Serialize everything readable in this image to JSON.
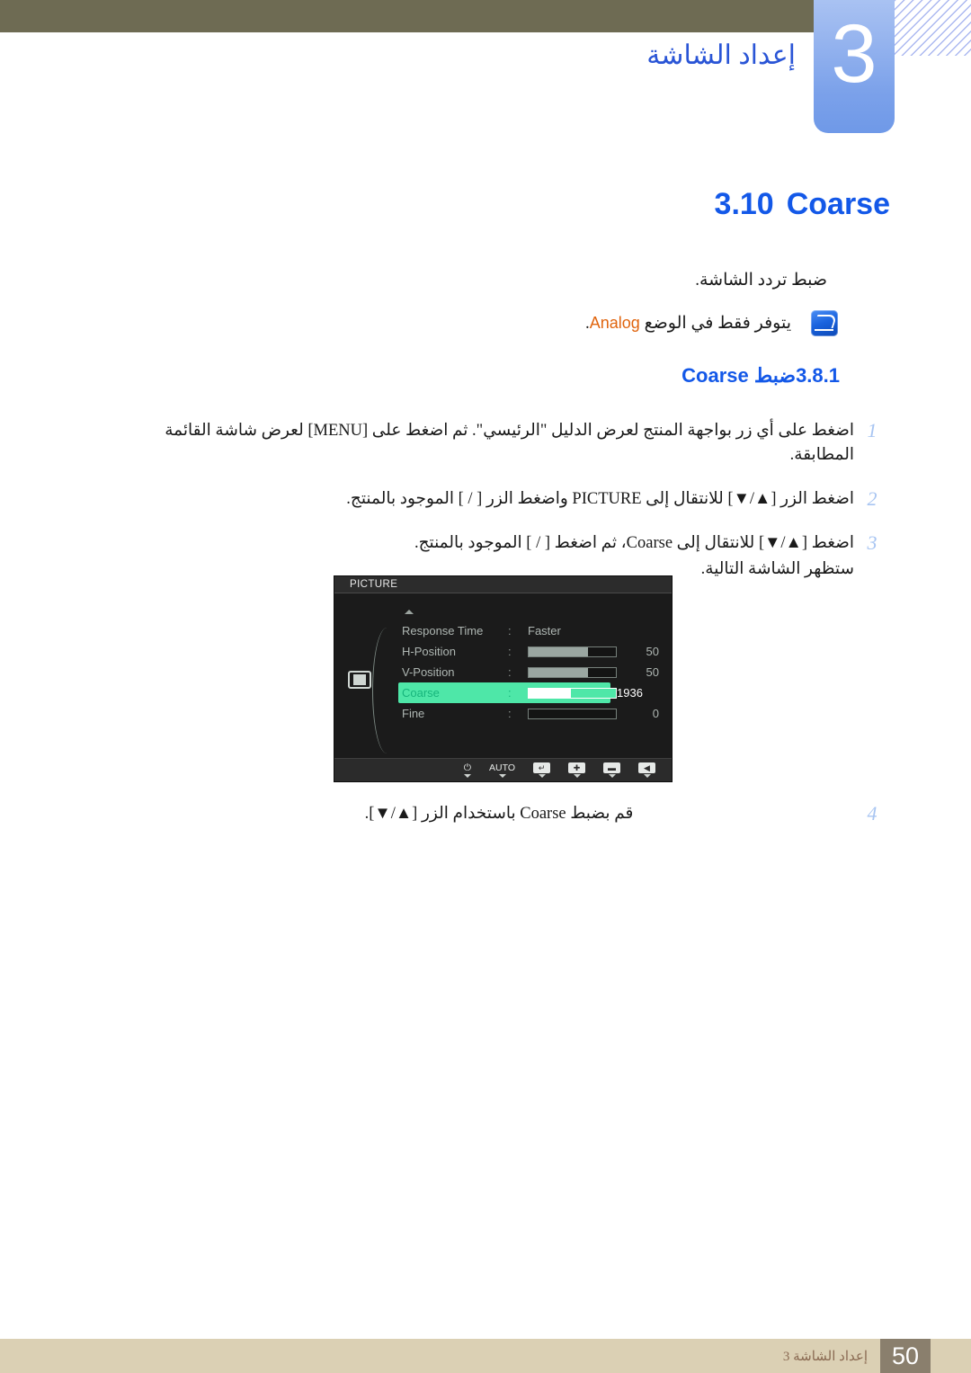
{
  "header": {
    "chapter_number": "3",
    "chapter_title": "إعداد الشاشة"
  },
  "section": {
    "number": "3.10",
    "title": "Coarse"
  },
  "intro": {
    "text": "ضبط تردد الشاشة."
  },
  "note": {
    "icon": "note-pencil-icon",
    "prefix": "يتوفر فقط في الوضع",
    "keyword": "Analog",
    "suffix": "."
  },
  "subsection": {
    "number": "3.8.1",
    "label_ar": "ضبط",
    "label_en": "Coarse"
  },
  "steps": [
    {
      "num": "1",
      "text": "اضغط على أي زر بواجهة المنتج لعرض الدليل \"الرئيسي\". ثم اضغط على [MENU] لعرض شاشة القائمة المطابقة."
    },
    {
      "num": "2",
      "text": "اضغط الزر [▲/▼] للانتقال إلى PICTURE واضغط الزر [ /  ] الموجود بالمنتج."
    },
    {
      "num": "3",
      "text": "اضغط [▲/▼] للانتقال إلى Coarse، ثم اضغط [ /  ] الموجود بالمنتج.",
      "sub": "ستظهر الشاشة التالية."
    },
    {
      "num": "4",
      "text": "قم بضبط Coarse باستخدام الزر [▲/▼]."
    }
  ],
  "osd": {
    "title": "PICTURE",
    "side_icon": "picture-bars-icon",
    "rows": [
      {
        "label": "Response Time",
        "colon": ":",
        "type": "value",
        "value": "Faster"
      },
      {
        "label": "H-Position",
        "colon": ":",
        "type": "bar",
        "fill": 68,
        "value": "50"
      },
      {
        "label": "V-Position",
        "colon": ":",
        "type": "bar",
        "fill": 68,
        "value": "50"
      },
      {
        "label": "Coarse",
        "colon": ":",
        "type": "bar",
        "fill": 48,
        "value": "1936",
        "selected": true
      },
      {
        "label": "Fine",
        "colon": ":",
        "type": "bar",
        "fill": 0,
        "value": "0"
      }
    ],
    "footer_buttons": [
      {
        "name": "left-arrow-button",
        "glyph": "◀"
      },
      {
        "name": "minus-button",
        "glyph": "▬"
      },
      {
        "name": "plus-button",
        "glyph": "✚"
      },
      {
        "name": "enter-button",
        "glyph": "↵"
      },
      {
        "name": "auto-button",
        "glyph": "AUTO"
      },
      {
        "name": "power-button",
        "glyph": "⏻"
      }
    ]
  },
  "footer": {
    "page_number": "50",
    "text": "إعداد الشاشة 3"
  },
  "colors": {
    "header_band": "#6e6b53",
    "chapter_tab": "#7ba1ea",
    "title_blue": "#1358e8",
    "keyword_orange": "#e0650f",
    "osd_highlight": "#4ee7a8",
    "footer_band": "#dbd0b4",
    "footer_page_box": "#8a7f6d"
  }
}
